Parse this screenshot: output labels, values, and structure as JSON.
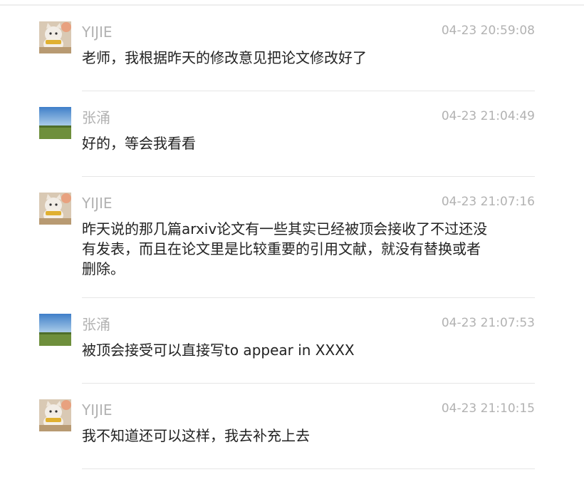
{
  "messages": [
    {
      "sender": "YIJIE",
      "avatar_icon": "cat-avatar-icon",
      "time": "04-23 20:59:08",
      "text": "老师，我根据昨天的修改意见把论文修改好了"
    },
    {
      "sender": "张涌",
      "avatar_icon": "landscape-avatar-icon",
      "time": "04-23 21:04:49",
      "text": "好的，等会我看看"
    },
    {
      "sender": "YIJIE",
      "avatar_icon": "cat-avatar-icon",
      "time": "04-23 21:07:16",
      "text": "昨天说的那几篇arxiv论文有一些其实已经被顶会接收了不过还没\n有发表，而且在论文里是比较重要的引用文献，就没有替换或者\n删除。"
    },
    {
      "sender": "张涌",
      "avatar_icon": "landscape-avatar-icon",
      "time": "04-23 21:07:53",
      "text": "被顶会接受可以直接写to appear in XXXX"
    },
    {
      "sender": "YIJIE",
      "avatar_icon": "cat-avatar-icon",
      "time": "04-23 21:10:15",
      "text": "我不知道还可以这样，我去补充上去"
    }
  ]
}
